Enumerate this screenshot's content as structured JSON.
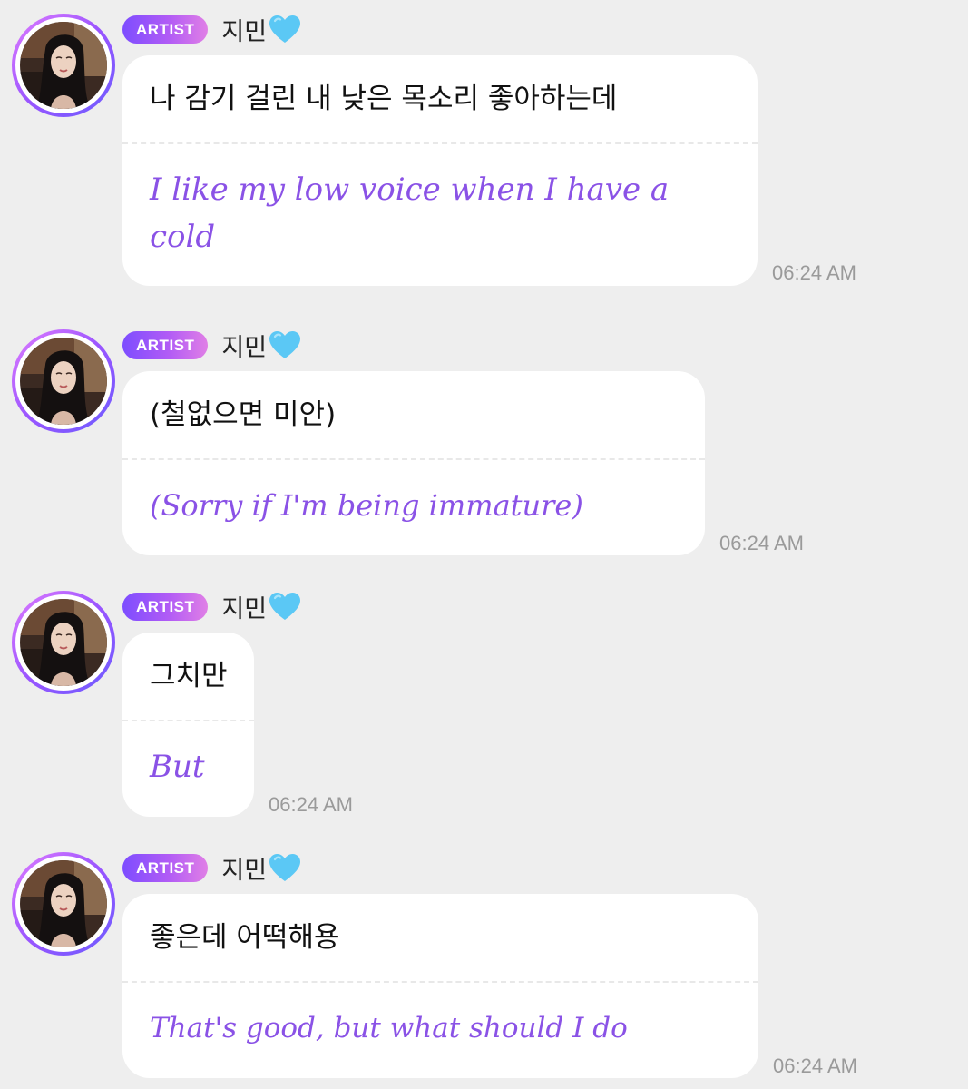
{
  "messages": [
    {
      "badge": "ARTIST",
      "name": "지민",
      "heart_icon": "blue-heart-icon",
      "korean": "나 감기 걸린 내 낮은 목소리 좋아하는데",
      "translation": "I like my low voice when I have a cold",
      "time": "06:24 AM"
    },
    {
      "badge": "ARTIST",
      "name": "지민",
      "heart_icon": "blue-heart-icon",
      "korean": "(철없으면 미안)",
      "translation": "(Sorry if I'm being immature)",
      "time": "06:24 AM"
    },
    {
      "badge": "ARTIST",
      "name": "지민",
      "heart_icon": "blue-heart-icon",
      "korean": "그치만",
      "translation": "But",
      "time": "06:24 AM"
    },
    {
      "badge": "ARTIST",
      "name": "지민",
      "heart_icon": "blue-heart-icon",
      "korean": "좋은데 어떡해용",
      "translation": "That's good, but what should I do",
      "time": "06:24 AM"
    }
  ],
  "colors": {
    "background": "#eeeeee",
    "bubble": "#ffffff",
    "translation": "#8a52e6",
    "badge_gradient_start": "#7d4dff",
    "badge_gradient_end": "#e07fe6",
    "heart": "#5bc8f5",
    "timestamp": "#9a9a9a"
  }
}
